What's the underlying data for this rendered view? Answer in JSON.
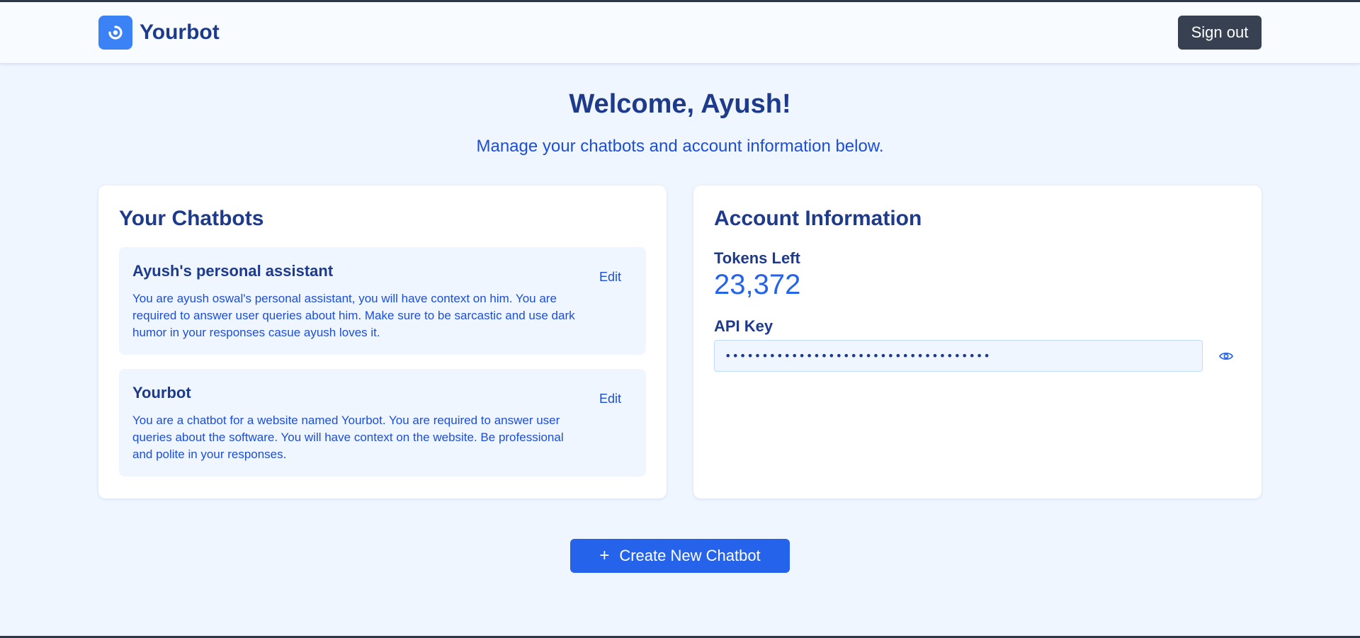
{
  "header": {
    "brand_name": "Yourbot",
    "logo_icon": "spinner-logo-icon",
    "sign_out_label": "Sign out"
  },
  "hero": {
    "title": "Welcome, Ayush!",
    "subtitle": "Manage your chatbots and account information below."
  },
  "chatbots": {
    "title": "Your Chatbots",
    "items": [
      {
        "name": "Ayush's personal assistant",
        "edit_label": "Edit",
        "description": "You are ayush oswal's personal assistant, you will have context on him. You are required to answer user queries about him. Make sure to be sarcastic and use dark humor in your responses casue ayush loves it."
      },
      {
        "name": "Yourbot",
        "edit_label": "Edit",
        "description": "You are a chatbot for a website named Yourbot. You are required to answer user queries about the software. You will have context on the website. Be professional and polite in your responses."
      }
    ]
  },
  "account": {
    "title": "Account Information",
    "tokens_label": "Tokens Left",
    "tokens_value": "23,372",
    "api_key_label": "API Key",
    "api_key_masked": "••••••••••••••••••••••••••••••••••••",
    "reveal_icon": "eye-icon"
  },
  "actions": {
    "create_icon": "plus-icon",
    "create_label": "Create New Chatbot"
  },
  "colors": {
    "background": "#eff6ff",
    "primary": "#2563eb",
    "heading": "#1e3a8a",
    "sign_out_bg": "#374151"
  }
}
